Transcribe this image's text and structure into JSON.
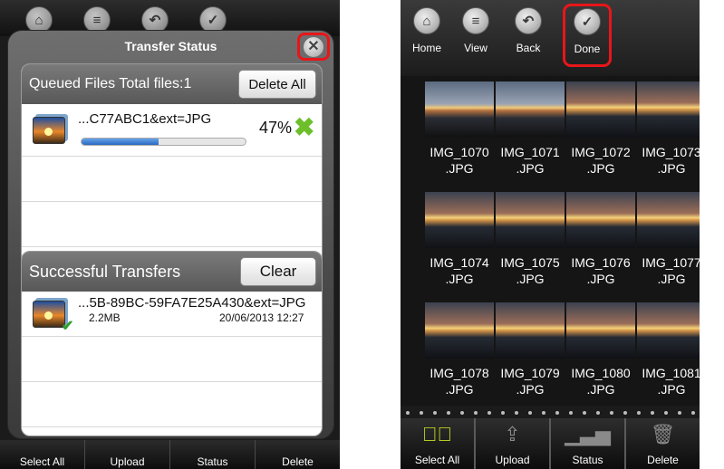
{
  "left": {
    "toolbar_icons": [
      "home-icon",
      "list-icon",
      "back-icon",
      "check-icon"
    ],
    "modal": {
      "title": "Transfer Status",
      "queued": {
        "header": "Queued Files Total files:1",
        "delete_all": "Delete All",
        "file_name": "...C77ABC1&ext=JPG",
        "progress": 0.47,
        "percent": "47%"
      },
      "success": {
        "header": "Successful Transfers",
        "clear": "Clear",
        "file_name": "...5B-89BC-59FA7E25A430&ext=JPG",
        "size": "2.2MB",
        "date": "20/06/2013 12:27"
      }
    },
    "bottom_bar": [
      "Select All",
      "Upload",
      "Status",
      "Delete"
    ]
  },
  "right": {
    "toolbar": [
      {
        "label": "Home",
        "icon": "home-icon"
      },
      {
        "label": "View",
        "icon": "list-icon"
      },
      {
        "label": "Back",
        "icon": "back-icon"
      },
      {
        "label": "Done",
        "icon": "check-icon"
      }
    ],
    "photos": [
      {
        "l1": "IMG_1070",
        "l2": ".JPG"
      },
      {
        "l1": "IMG_1071",
        "l2": ".JPG"
      },
      {
        "l1": "IMG_1072",
        "l2": ".JPG"
      },
      {
        "l1": "IMG_1073",
        "l2": ".JPG"
      },
      {
        "l1": "IMG_1074",
        "l2": ".JPG"
      },
      {
        "l1": "IMG_1075",
        "l2": ".JPG"
      },
      {
        "l1": "IMG_1076",
        "l2": ".JPG"
      },
      {
        "l1": "IMG_1077",
        "l2": ".JPG"
      },
      {
        "l1": "IMG_1078",
        "l2": ".JPG"
      },
      {
        "l1": "IMG_1079",
        "l2": ".JPG"
      },
      {
        "l1": "IMG_1080",
        "l2": ".JPG"
      },
      {
        "l1": "IMG_1081",
        "l2": ".JPG"
      }
    ],
    "bottom_bar": [
      {
        "label": "Select All",
        "icon": "checkmark-circle-icon"
      },
      {
        "label": "Upload",
        "icon": "upload-icon"
      },
      {
        "label": "Status",
        "icon": "bar-chart-icon"
      },
      {
        "label": "Delete",
        "icon": "trash-icon"
      }
    ]
  },
  "colors": {
    "highlight": "#e8161a",
    "accent_green": "#c9e021",
    "progress": "#2a68c2"
  }
}
